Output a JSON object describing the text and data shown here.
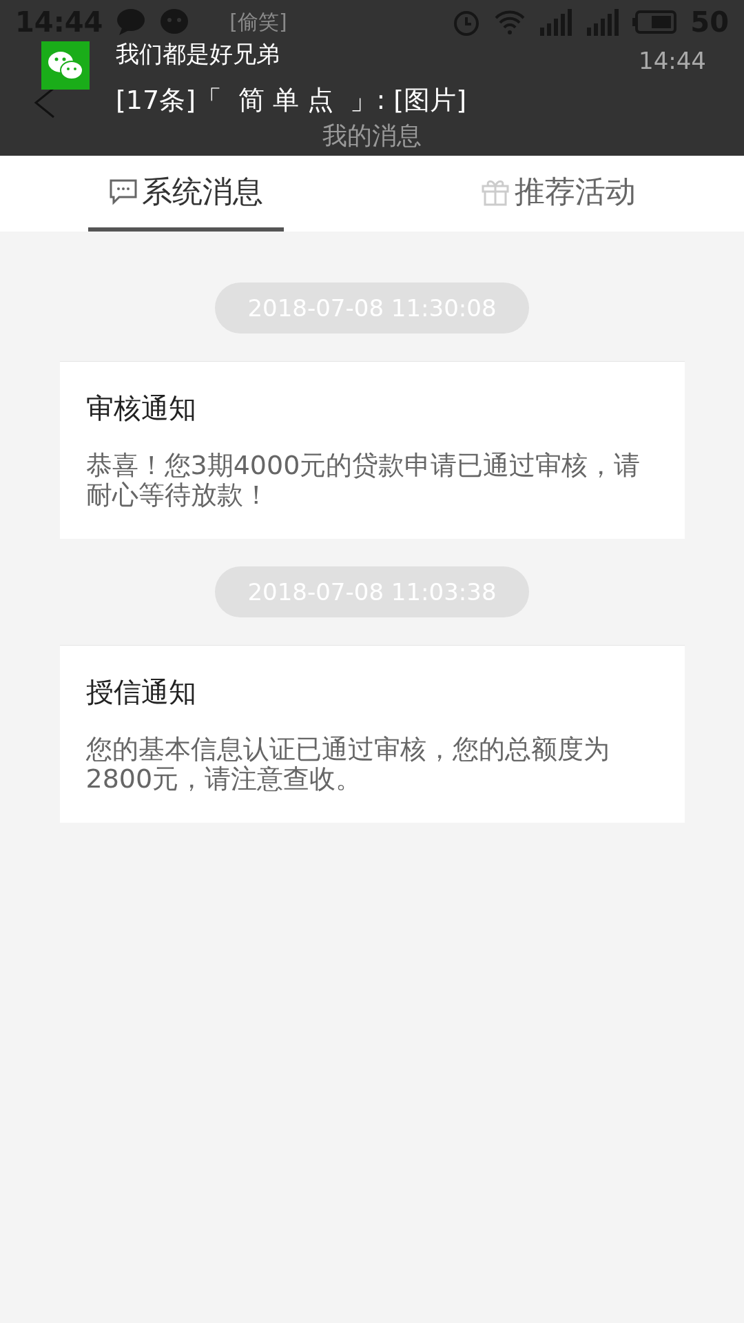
{
  "status_bar": {
    "time": "14:44",
    "ticker": "[偷笑]",
    "battery": "50"
  },
  "notification": {
    "sender": "我们都是好兄弟",
    "message": "[17条]「  简 单 点  」: [图片]",
    "time": "14:44"
  },
  "app_bar": {
    "title": "我的消息"
  },
  "tabs": [
    {
      "label": "系统消息",
      "kind": "chat",
      "selected": true
    },
    {
      "label": "推荐活动",
      "kind": "gift",
      "selected": false
    }
  ],
  "messages": [
    {
      "time": "2018-07-08 11:30:08",
      "title": "审核通知",
      "body": "恭喜！您3期4000元的贷款申请已通过审核，请耐心等待放款！"
    },
    {
      "time": "2018-07-08 11:03:38",
      "title": "授信通知",
      "body": "您的基本信息认证已通过审核，您的总额度为2800元，请注意查收。"
    }
  ]
}
